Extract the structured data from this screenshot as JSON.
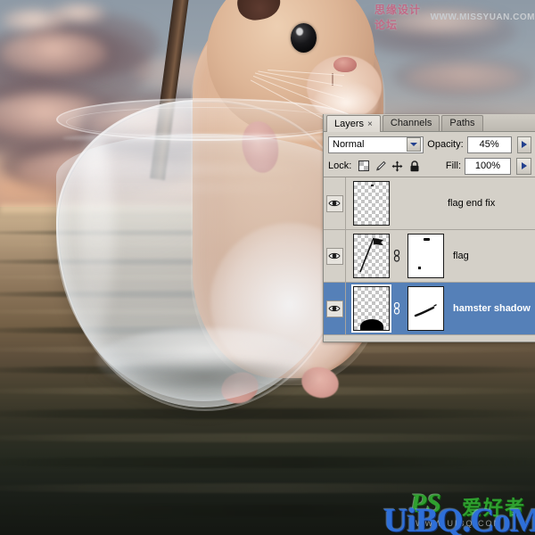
{
  "app": {
    "name": "Adobe Photoshop Layers Panel",
    "document_subject": "hamster in a glass fishbowl floating on sunset ocean"
  },
  "panel": {
    "tabs": [
      {
        "label": "Layers",
        "active": true,
        "close_icon": "×"
      },
      {
        "label": "Channels",
        "active": false
      },
      {
        "label": "Paths",
        "active": false
      }
    ],
    "blend_mode": {
      "value": "Normal",
      "icon": "chevron-down-icon"
    },
    "opacity": {
      "label": "Opacity:",
      "value": "45%",
      "spinner_icon": "▶"
    },
    "fill": {
      "label": "Fill:",
      "value": "100%",
      "spinner_icon": "▶"
    },
    "lock": {
      "label": "Lock:",
      "icons": [
        "lock-transparency-icon",
        "lock-image-pixels-icon",
        "lock-position-icon",
        "lock-all-icon"
      ]
    },
    "layers": [
      {
        "name": "flag end fix",
        "visible": true,
        "selected": false,
        "has_mask": false,
        "thumbnail": "transparent-checker",
        "eye_icon": "eye-icon"
      },
      {
        "name": "flag",
        "visible": true,
        "selected": false,
        "has_mask": true,
        "thumbnail": "transparent-checker-with-flag",
        "mask_thumbnail": "white-mask-with-marks",
        "link_icon": "chain-link-icon",
        "eye_icon": "eye-icon"
      },
      {
        "name": "hamster shadow",
        "visible": true,
        "selected": true,
        "has_mask": true,
        "thumbnail": "transparent-checker-with-shadow",
        "mask_thumbnail": "white-mask-with-stroke",
        "link_icon": "chain-link-icon",
        "eye_icon": "eye-icon"
      }
    ],
    "colors": {
      "panel_bg": "#d4d0c8",
      "selection_blue": "#5580b8",
      "field_bg": "#ffffff",
      "border": "#8a8a84"
    }
  },
  "watermarks": {
    "top": {
      "chinese": "思缘设计论坛",
      "url": "WWW.MISSYUAN.COM",
      "chinese_color": "#c06a86",
      "url_color": "#c8ccd0"
    },
    "bottom": {
      "ps_text": "PS",
      "chinese": "爱好者",
      "site": "UiBQ.CoM",
      "sub_url": "WWW.UIBQ.COM",
      "green_color": "#2fa02f",
      "blue_color": "#2e6fd8"
    }
  },
  "scene": {
    "sky_label": "sunset sky with clouds",
    "sea_label": "ocean water",
    "bowl_label": "glass fishbowl",
    "hamster_label": "hamster",
    "pole_label": "flag pole"
  }
}
